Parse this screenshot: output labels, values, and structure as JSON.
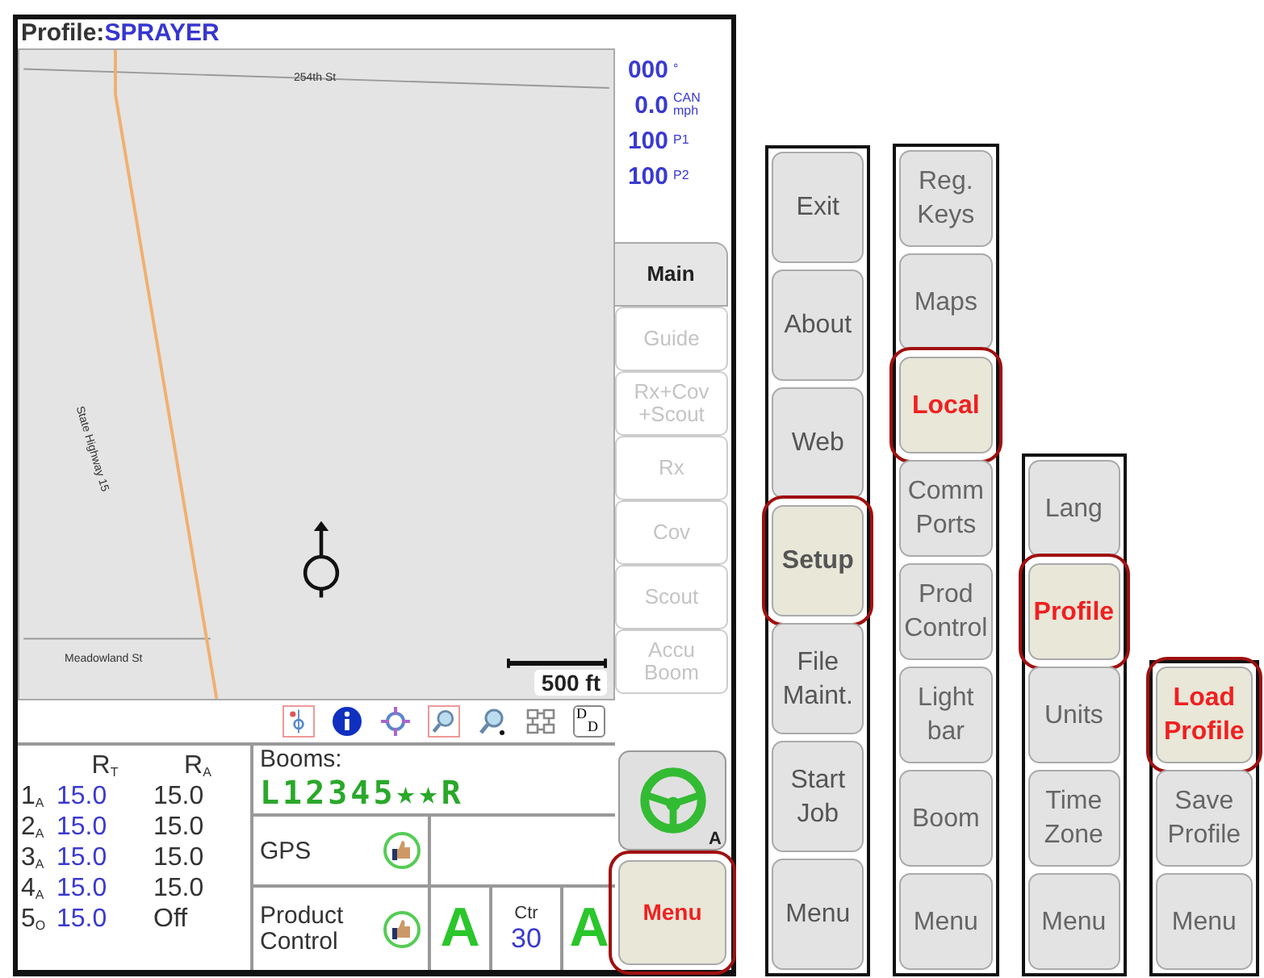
{
  "header": {
    "label": "Profile:",
    "value": "SPRAYER"
  },
  "map": {
    "streets": [
      "254th St",
      "State Highway 15",
      "Meadowland St"
    ],
    "scale": "500 ft"
  },
  "readouts": [
    {
      "value": "000",
      "unit": "°"
    },
    {
      "value": "0.0",
      "unit": "CAN mph"
    },
    {
      "value": "100",
      "unit": "P1"
    },
    {
      "value": "100",
      "unit": "P2"
    }
  ],
  "tabs": [
    {
      "label": "Main",
      "selected": true,
      "disabled": false
    },
    {
      "label": "Guide",
      "selected": false,
      "disabled": true
    },
    {
      "label": "Rx+Cov +Scout",
      "selected": false,
      "disabled": true
    },
    {
      "label": "Rx",
      "selected": false,
      "disabled": true
    },
    {
      "label": "Cov",
      "selected": false,
      "disabled": true
    },
    {
      "label": "Scout",
      "selected": false,
      "disabled": true
    },
    {
      "label": "Accu Boom",
      "selected": false,
      "disabled": true
    }
  ],
  "toolbar": {
    "dd_letters": [
      "D",
      "D"
    ]
  },
  "rates": {
    "headers": [
      "R$_{T}$",
      "R$_{A}$"
    ],
    "rows": [
      {
        "label": "1$_{A}$",
        "target": "15.0",
        "actual": "15.0"
      },
      {
        "label": "2$_{A}$",
        "target": "15.0",
        "actual": "15.0"
      },
      {
        "label": "3$_{A}$",
        "target": "15.0",
        "actual": "15.0"
      },
      {
        "label": "4$_{A}$",
        "target": "15.0",
        "actual": "15.0"
      },
      {
        "label": "5$_{O}$",
        "target": "15.0",
        "actual": "Off"
      }
    ]
  },
  "booms": {
    "label": "Booms:",
    "sections": "L12345★★R"
  },
  "gps": {
    "label": "GPS"
  },
  "product_control": {
    "label": "Product Control",
    "mode_left": "A",
    "center_label": "Ctr",
    "center_value": "30",
    "mode_right": "A"
  },
  "steering": {
    "mode": "A"
  },
  "menu_button": {
    "label": "Menu",
    "selected": true
  },
  "menus": [
    {
      "buttons": [
        {
          "label": "Exit",
          "selected": false
        },
        {
          "label": "About",
          "selected": false
        },
        {
          "label": "Web",
          "selected": false
        },
        {
          "label": "Setup",
          "selected": true
        },
        {
          "label": "File Maint.",
          "selected": false
        },
        {
          "label": "Start Job",
          "selected": false
        },
        {
          "label": "Menu",
          "selected": false
        }
      ]
    },
    {
      "buttons": [
        {
          "label": "Reg. Keys",
          "selected": false
        },
        {
          "label": "Maps",
          "selected": false
        },
        {
          "label": "Local",
          "selected": true
        },
        {
          "label": "Comm Ports",
          "selected": false
        },
        {
          "label": "Prod Control",
          "selected": false
        },
        {
          "label": "Light bar",
          "selected": false
        },
        {
          "label": "Boom",
          "selected": false
        },
        {
          "label": "Menu",
          "selected": false
        }
      ]
    },
    {
      "buttons": [
        {
          "label": "Lang",
          "selected": false
        },
        {
          "label": "Profile",
          "selected": true
        },
        {
          "label": "Units",
          "selected": false
        },
        {
          "label": "Time Zone",
          "selected": false
        },
        {
          "label": "Menu",
          "selected": false
        }
      ]
    },
    {
      "buttons": [
        {
          "label": "Load Profile",
          "selected": true
        },
        {
          "label": "Save Profile",
          "selected": false
        },
        {
          "label": "Menu",
          "selected": false
        }
      ]
    }
  ]
}
